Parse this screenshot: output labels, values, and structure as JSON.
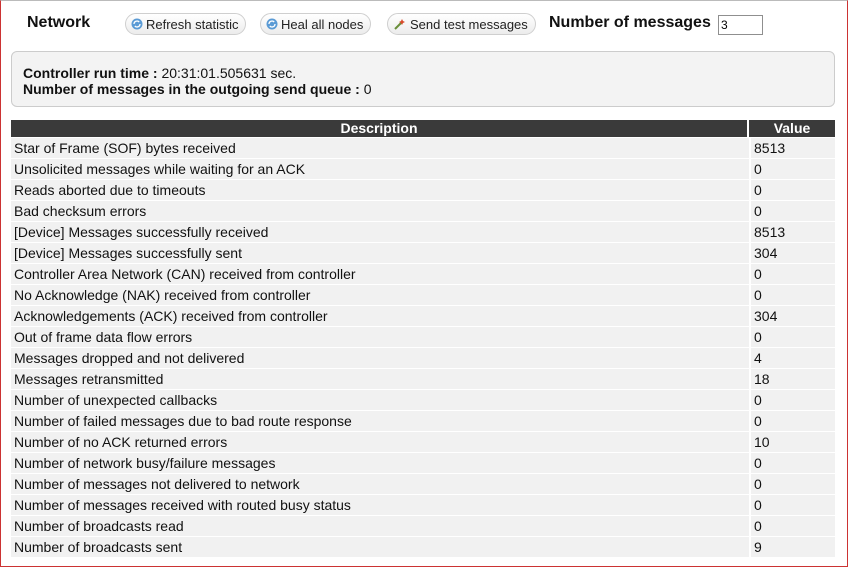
{
  "toolbar": {
    "title": "Network",
    "refresh_label": "Refresh statistic",
    "heal_label": "Heal all nodes",
    "send_label": "Send test messages",
    "num_messages_label": "Number of messages",
    "num_messages_value": "3"
  },
  "info": {
    "runtime_label": "Controller run time :",
    "runtime_value": "20:31:01.505631 sec.",
    "queue_label": "Number of messages in the outgoing send queue :",
    "queue_value": "0"
  },
  "table": {
    "headers": [
      "Description",
      "Value"
    ],
    "rows": [
      [
        "Star of Frame (SOF) bytes received",
        "8513"
      ],
      [
        "Unsolicited messages while waiting for an ACK",
        "0"
      ],
      [
        "Reads aborted due to timeouts",
        "0"
      ],
      [
        "Bad checksum errors",
        "0"
      ],
      [
        "[Device] Messages successfully received",
        "8513"
      ],
      [
        "[Device] Messages successfully sent",
        "304"
      ],
      [
        "Controller Area Network (CAN) received from controller",
        "0"
      ],
      [
        "No Acknowledge (NAK) received from controller",
        "0"
      ],
      [
        "Acknowledgements (ACK) received from controller",
        "304"
      ],
      [
        "Out of frame data flow errors",
        "0"
      ],
      [
        "Messages dropped and not delivered",
        "4"
      ],
      [
        "Messages retransmitted",
        "18"
      ],
      [
        "Number of unexpected callbacks",
        "0"
      ],
      [
        "Number of failed messages due to bad route response",
        "0"
      ],
      [
        "Number of no ACK returned errors",
        "10"
      ],
      [
        "Number of network busy/failure messages",
        "0"
      ],
      [
        "Number of messages not delivered to network",
        "0"
      ],
      [
        "Number of messages received with routed busy status",
        "0"
      ],
      [
        "Number of broadcasts read",
        "0"
      ],
      [
        "Number of broadcasts sent",
        "9"
      ]
    ]
  },
  "icons": {
    "refresh": "refresh-icon",
    "heal": "refresh-icon",
    "send": "wand-icon"
  },
  "colors": {
    "header_bg": "#3a3a3a",
    "row_bg": "#f1f1f1",
    "panel_bg": "#f3f3f3",
    "frame_border": "#cc3333"
  }
}
